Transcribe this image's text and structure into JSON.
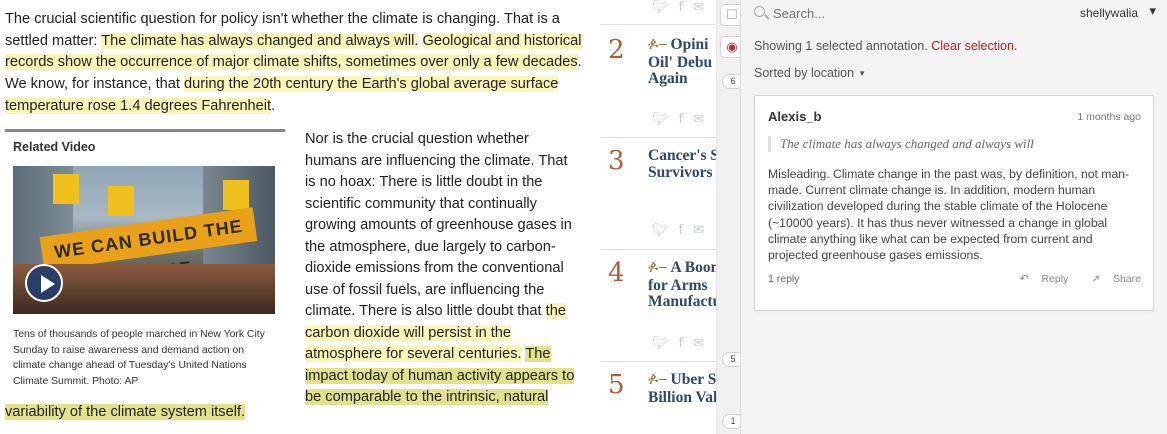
{
  "article": {
    "para1": {
      "p1": "The crucial scientific question for policy isn't whether the climate is changing. That is a settled matter: ",
      "h1": "The climate has always changed and always will.",
      "p2": " ",
      "h2": "Geological and historical records show the occurrence of major climate shifts, sometimes over only a few decades",
      "p3": ". We know, for instance, that ",
      "h3": "during the 20th century the Earth's global average surface temperature rose 1.4 degrees Fahrenheit",
      "p4": "."
    },
    "related": {
      "title": "Related Video",
      "banner": "WE CAN BUILD THE FUTURE",
      "caption": "Tens of thousands of people marched in New York City Sunday to raise awareness and demand action on climate change ahead of Tuesday's United Nations Climate Summit. Photo: AP"
    },
    "para2": {
      "p1": "Nor is the crucial question whether humans are influencing the climate. That is no hoax: There is little doubt in the scientific community that continually growing amounts of greenhouse gases in the atmosphere, due largely to carbon-dioxide emissions from the conventional use of fossil fuels, are influencing the climate. There is also little doubt that ",
      "h1": "the carbon dioxide will persist in the atmosphere for several centuries.",
      "p2": " ",
      "h2": "The impact today of human activity appears to be comparable to the intrinsic, natural"
    },
    "tail": "variability of the climate system itself."
  },
  "popular": {
    "share_icons": [
      "twitter-icon",
      "facebook-icon",
      "email-icon",
      "comment-icon"
    ],
    "items": [
      {
        "rank": "2",
        "line1": "Opini",
        "line2": "Oil' Debu",
        "line3": "Again"
      },
      {
        "rank": "3",
        "line1": "Cancer's Sur",
        "line2": "Survivors",
        "line3": ""
      },
      {
        "rank": "4",
        "line1": "A Boom M",
        "line2": "for Arms",
        "line3": "Manufacture"
      },
      {
        "rank": "5",
        "line1": "Uber Snap",
        "line2": "Billion Valu",
        "line3": ""
      }
    ]
  },
  "gutter": {
    "badges": [
      "6",
      "5",
      "1"
    ]
  },
  "sidebar": {
    "search_placeholder": "Search...",
    "user": "shellywalia",
    "showing": "Showing 1 selected annotation.",
    "clear": "Clear selection.",
    "sorted": "Sorted by location",
    "annotation": {
      "user": "Alexis_b",
      "time": "1 months ago",
      "quote": "The climate has always changed and always will",
      "body": "Misleading. Climate change in the past was, by definition, not man-made. Current climate change is. In addition, modern human civilization developed during the stable climate of the Holocene (~10000 years). It has thus never witnessed a change in global climate anything like what can be expected from current and projected greenhouse gases emissions.",
      "replies": "1 reply",
      "reply_label": "Reply",
      "share_label": "Share"
    }
  },
  "colors": {
    "highlight": "#fbf6b8",
    "highlight_selected": "#e3e28c",
    "rank": "#b25d36",
    "headline": "#2d4a6b",
    "clear_link": "#bd1c2b"
  }
}
